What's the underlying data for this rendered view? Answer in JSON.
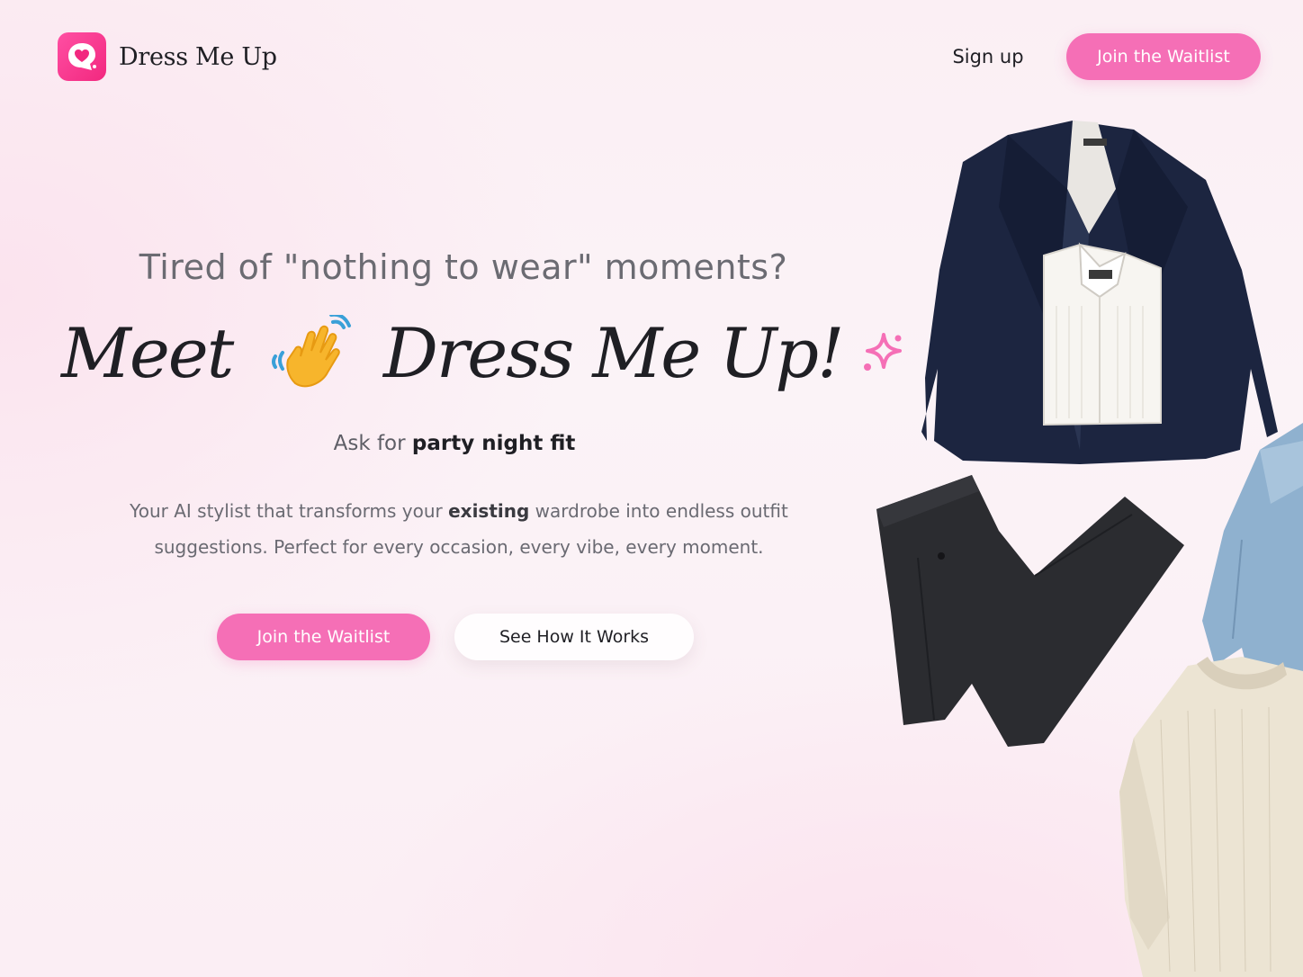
{
  "header": {
    "brand_name": "Dress Me Up",
    "signup_label": "Sign up",
    "join_label": "Join the Waitlist"
  },
  "hero": {
    "eyebrow": "Tired of \"nothing to wear\" moments?",
    "headline_meet": "Meet",
    "headline_brand": "Dress Me Up!",
    "ask_prefix": "Ask for",
    "ask_example": "party night fit",
    "description_part1": "Your AI stylist that transforms your",
    "description_emphasis": "existing",
    "description_part2": "wardrobe into endless outfit suggestions. Perfect for every occasion, every vibe, every moment.",
    "primary_cta": "Join the Waitlist",
    "secondary_cta": "See How It Works"
  },
  "icons": {
    "logo": "heart-chat-icon",
    "wave": "waving-hand-icon",
    "sparkle": "sparkle-icon"
  },
  "colors": {
    "brand_pink": "#f56fb6",
    "logo_pink": "#f2287f",
    "text_dark": "#1f1f24",
    "text_muted": "#6b6b72"
  },
  "illustration": {
    "items": [
      "navy-blazer",
      "white-shirt",
      "charcoal-trousers",
      "denim-jacket",
      "cream-sweater"
    ]
  }
}
